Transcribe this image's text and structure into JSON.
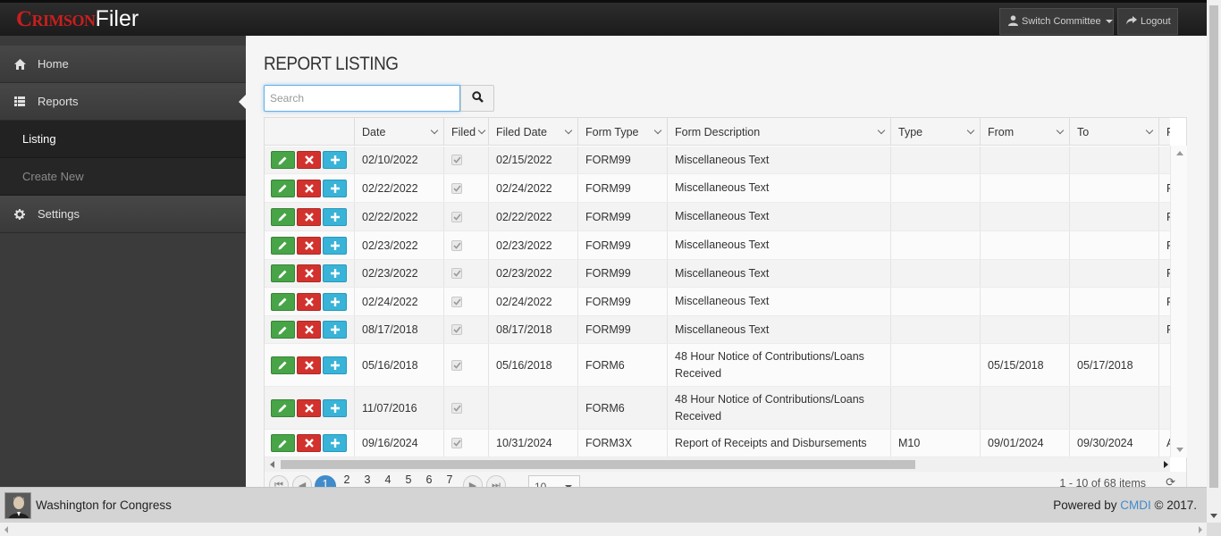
{
  "app": {
    "brand_crimson": "Crimson",
    "brand_filer": "Filer"
  },
  "topbar": {
    "switch_label": "Switch Committee",
    "logout_label": "Logout"
  },
  "sidebar": {
    "items": [
      {
        "label": "Home",
        "icon": "home-icon"
      },
      {
        "label": "Reports",
        "icon": "list-icon",
        "active": true
      },
      {
        "label": "Settings",
        "icon": "gear-icon"
      }
    ],
    "sub_items": [
      {
        "label": "Listing",
        "current": true
      },
      {
        "label": "Create New",
        "current": false
      }
    ]
  },
  "main": {
    "title": "REPORT LISTING",
    "search_placeholder": "Search"
  },
  "grid": {
    "columns": [
      "Date",
      "Filed",
      "Filed Date",
      "Form Type",
      "Form Description",
      "Type",
      "From",
      "To",
      "F"
    ],
    "rows": [
      {
        "date": "02/10/2022",
        "filed": true,
        "filed_date": "02/15/2022",
        "form_type": "FORM99",
        "description": "Miscellaneous Text",
        "type": "",
        "from": "",
        "to": "",
        "extra": ""
      },
      {
        "date": "02/22/2022",
        "filed": true,
        "filed_date": "02/24/2022",
        "form_type": "FORM99",
        "description": "Miscellaneous Text",
        "type": "",
        "from": "",
        "to": "",
        "extra": "F"
      },
      {
        "date": "02/22/2022",
        "filed": true,
        "filed_date": "02/22/2022",
        "form_type": "FORM99",
        "description": "Miscellaneous Text",
        "type": "",
        "from": "",
        "to": "",
        "extra": "F"
      },
      {
        "date": "02/23/2022",
        "filed": true,
        "filed_date": "02/23/2022",
        "form_type": "FORM99",
        "description": "Miscellaneous Text",
        "type": "",
        "from": "",
        "to": "",
        "extra": "F"
      },
      {
        "date": "02/23/2022",
        "filed": true,
        "filed_date": "02/23/2022",
        "form_type": "FORM99",
        "description": "Miscellaneous Text",
        "type": "",
        "from": "",
        "to": "",
        "extra": "F"
      },
      {
        "date": "02/24/2022",
        "filed": true,
        "filed_date": "02/24/2022",
        "form_type": "FORM99",
        "description": "Miscellaneous Text",
        "type": "",
        "from": "",
        "to": "",
        "extra": "F"
      },
      {
        "date": "08/17/2018",
        "filed": true,
        "filed_date": "08/17/2018",
        "form_type": "FORM99",
        "description": "Miscellaneous Text",
        "type": "",
        "from": "",
        "to": "",
        "extra": "F"
      },
      {
        "date": "05/16/2018",
        "filed": true,
        "filed_date": "05/16/2018",
        "form_type": "FORM6",
        "description": "48 Hour Notice of Contributions/Loans Received",
        "type": "",
        "from": "05/15/2018",
        "to": "05/17/2018",
        "extra": ""
      },
      {
        "date": "11/07/2016",
        "filed": true,
        "filed_date": "",
        "form_type": "FORM6",
        "description": "48 Hour Notice of Contributions/Loans Received",
        "type": "",
        "from": "",
        "to": "",
        "extra": ""
      },
      {
        "date": "09/16/2024",
        "filed": true,
        "filed_date": "10/31/2024",
        "form_type": "FORM3X",
        "description": "Report of Receipts and Disbursements",
        "type": "M10",
        "from": "09/01/2024",
        "to": "09/30/2024",
        "extra": "A"
      }
    ]
  },
  "pager": {
    "pages": [
      "1",
      "2",
      "3",
      "4",
      "5",
      "6",
      "7"
    ],
    "current_page": "1",
    "page_size": "10",
    "info": "1 - 10 of 68 items"
  },
  "footer": {
    "committee": "Washington for Congress",
    "powered_prefix": "Powered by ",
    "powered_link": "CMDI",
    "powered_suffix": " © 2017."
  },
  "colors": {
    "brand_red": "#c91e1e",
    "edit_green": "#47a447",
    "delete_red": "#d2322d",
    "add_blue": "#39b3d7",
    "accent_blue": "#428bca"
  }
}
